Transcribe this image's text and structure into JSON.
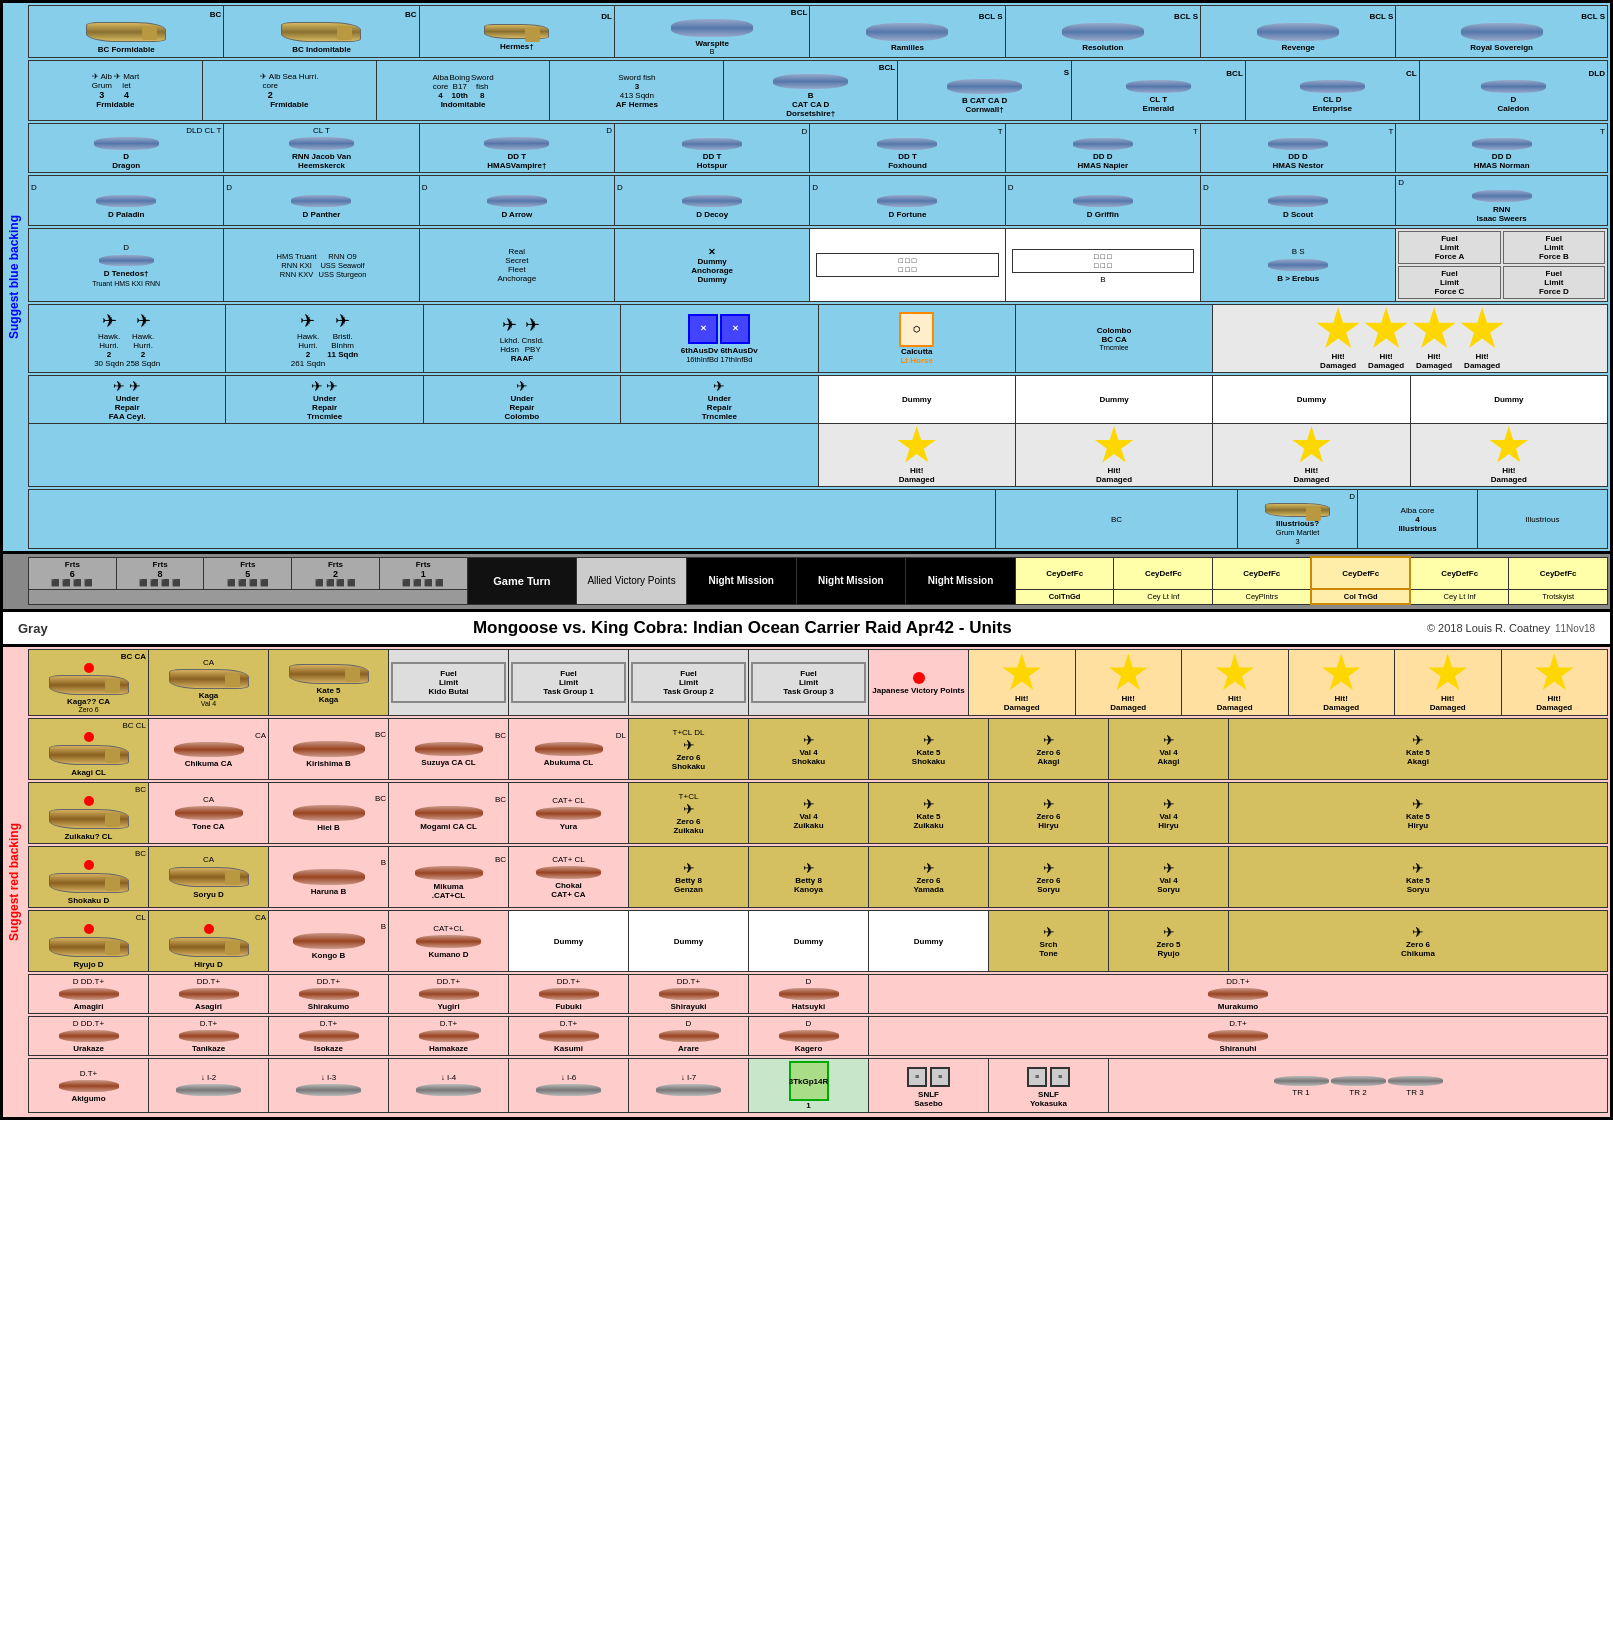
{
  "title": "Mongoose vs. King Cobra:  Indian Ocean Carrier Raid Apr42 - Units",
  "copyright": "© 2018 Louis R. Coatney",
  "version": "11Nov18",
  "suggest_blue": "Suggest blue backing",
  "suggest_red": "Suggest red backing",
  "gray_label": "Gray",
  "game_turn_label": "Game Turn",
  "allied_vp_label": "Allied Victory Points",
  "japanese_vp_label": "Japanese Victory Points",
  "night_mission_label": "Night Mission",
  "hit_damaged_label": "Hit! Damaged",
  "dummy_label": "Dummy",
  "under_repair_label": "Under Repair",
  "fuel_limit_label": "Fuel Limit",
  "blue_ships": [
    {
      "name": "Formidable",
      "type": "BC",
      "bg": "blue"
    },
    {
      "name": "Indomitable",
      "type": "BC",
      "bg": "blue"
    },
    {
      "name": "Hermes†",
      "type": "DL",
      "bg": "blue"
    },
    {
      "name": "Warspite",
      "type": "BCL",
      "bg": "blue"
    },
    {
      "name": "Ramilles",
      "type": "BCL S",
      "bg": "blue"
    },
    {
      "name": "Resolution",
      "type": "BCL S",
      "bg": "blue"
    },
    {
      "name": "Revenge",
      "type": "BCL S",
      "bg": "blue"
    },
    {
      "name": "Royal Sovereign",
      "type": "BCL S",
      "bg": "blue"
    }
  ],
  "blue_cruisers": [
    {
      "name": "Dorsetshire†",
      "type": "BCL",
      "bg": "blue"
    },
    {
      "name": "Cornwall†",
      "type": "S",
      "bg": "blue"
    },
    {
      "name": "Emerald",
      "type": "BCL",
      "bg": "blue"
    },
    {
      "name": "Enterprise",
      "type": "CL",
      "bg": "blue"
    },
    {
      "name": "Caledon",
      "type": "DLD",
      "bg": "blue"
    }
  ],
  "blue_destroyers": [
    {
      "name": "Dragon",
      "type": "DLD",
      "bg": "blue"
    },
    {
      "name": "RNN Jacob Van Heemskerck",
      "type": "CL",
      "bg": "blue"
    },
    {
      "name": "HMASVampire†",
      "type": "DD",
      "bg": "blue"
    },
    {
      "name": "Hotspur",
      "type": "T",
      "bg": "blue"
    },
    {
      "name": "Foxhound",
      "type": "T",
      "bg": "blue"
    },
    {
      "name": "HMAS Napier",
      "type": "DD",
      "bg": "blue"
    },
    {
      "name": "HMAS Nestor",
      "type": "DD",
      "bg": "blue"
    },
    {
      "name": "HMAS Norman",
      "type": "DD",
      "bg": "blue"
    }
  ],
  "fuel_limits": [
    "Force A",
    "Force B",
    "Force C",
    "Force D"
  ],
  "red_carriers": [
    {
      "name": "Kaga??",
      "type": "BC CA"
    },
    {
      "name": "Kaga",
      "type": "CA"
    },
    {
      "name": "Kaga",
      "type": "CA"
    },
    {
      "name": "Kaga",
      "type": ""
    }
  ],
  "red_ships": [
    {
      "name": "Akagi",
      "type": "BC CL"
    },
    {
      "name": "Chikuma",
      "type": "CA"
    },
    {
      "name": "Kirishima",
      "type": ""
    },
    {
      "name": "Suzuya",
      "type": "CA CL"
    },
    {
      "name": "Abukuma",
      "type": "DL"
    },
    {
      "name": "Shokaku",
      "type": ""
    },
    {
      "name": "Shokaku",
      "type": ""
    },
    {
      "name": "Shokaku",
      "type": ""
    },
    {
      "name": "Akagi",
      "type": ""
    },
    {
      "name": "Akagi",
      "type": ""
    }
  ]
}
